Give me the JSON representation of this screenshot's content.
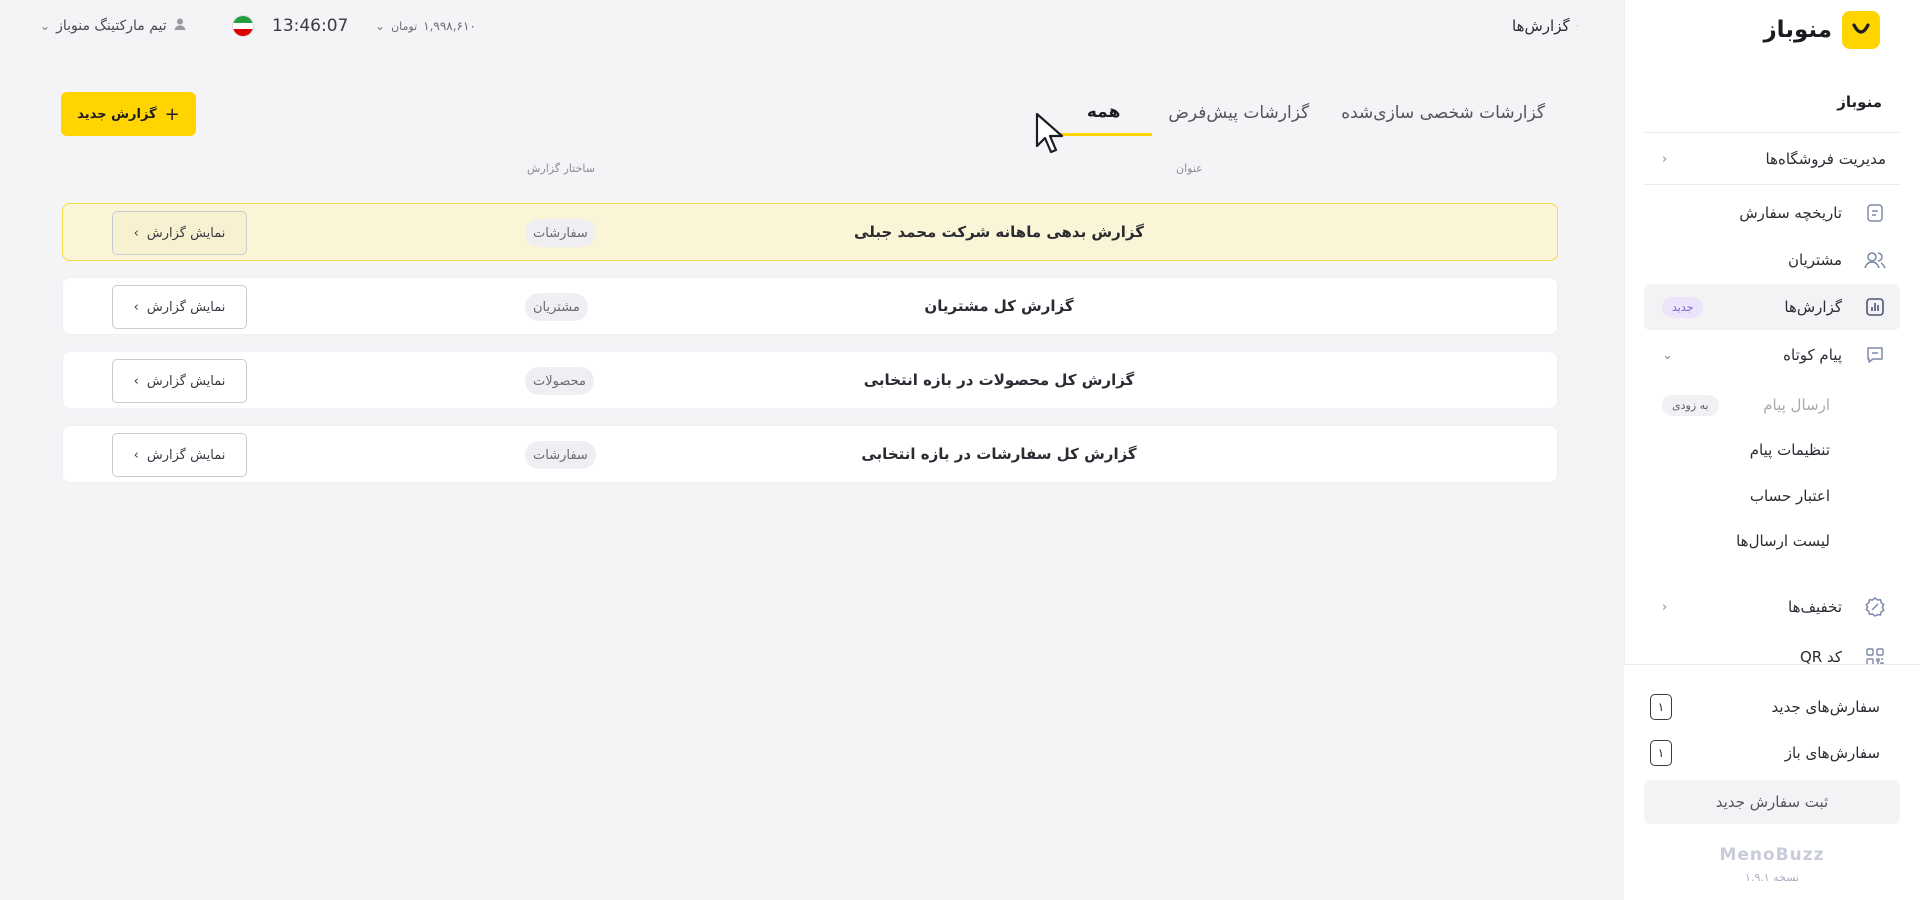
{
  "sidebar": {
    "brand": "منوباز",
    "section_title": "منوباز",
    "store_management": "مدیریت فروشگاه‌ها",
    "items": [
      {
        "label": "تاریخچه سفارش",
        "icon": "document-icon"
      },
      {
        "label": "مشتریان",
        "icon": "users-icon"
      },
      {
        "label": "گزارش‌ها",
        "icon": "chart-icon",
        "badge": "جدید"
      },
      {
        "label": "پیام کوتاه",
        "icon": "message-icon"
      }
    ],
    "sms_sub": [
      {
        "label": "ارسال پیام",
        "badge": "به زودی"
      },
      {
        "label": "تنظیمات پیام"
      },
      {
        "label": "اعتبار حساب"
      },
      {
        "label": "لیست ارسال‌ها"
      }
    ],
    "discounts": "تخفیف‌ها",
    "qr": "کد QR",
    "new_orders_label": "سفارش‌های جدید",
    "new_orders_count": "۱",
    "open_orders_label": "سفارش‌های باز",
    "open_orders_count": "۱",
    "new_order_button": "ثبت سفارش جدید",
    "footer_logo": "MenoBuzz",
    "version": "نسخه ۱.۹.۱"
  },
  "topbar": {
    "page_title": "گزارش‌ها",
    "balance": "۱,۹۹۸,۶۱۰",
    "currency": "تومان",
    "clock": "13:46:07",
    "user": "تیم مارکتینگ منوباز"
  },
  "main": {
    "new_report_button": "گزارش جدید",
    "tabs": [
      "همه",
      "گزارشات پیش‌فرض",
      "گزارشات شخصی سازی‌شده"
    ],
    "col_title": "عنوان",
    "col_structure": "ساختار گزارش",
    "show_label": "نمایش گزارش",
    "reports": [
      {
        "title": "گزارش بدهی ماهانه شرکت محمد جبلی",
        "type": "سفارشات"
      },
      {
        "title": "گزارش کل مشتریان",
        "type": "مشتریان"
      },
      {
        "title": "گزارش کل محصولات در بازه انتخابی",
        "type": "محصولات"
      },
      {
        "title": "گزارش کل سفارشات در بازه انتخابی",
        "type": "سفارشات"
      }
    ]
  },
  "colors": {
    "accent": "#ffd400",
    "highlight_row": "#fbf5d7",
    "new_badge": "#ebe4fb"
  }
}
